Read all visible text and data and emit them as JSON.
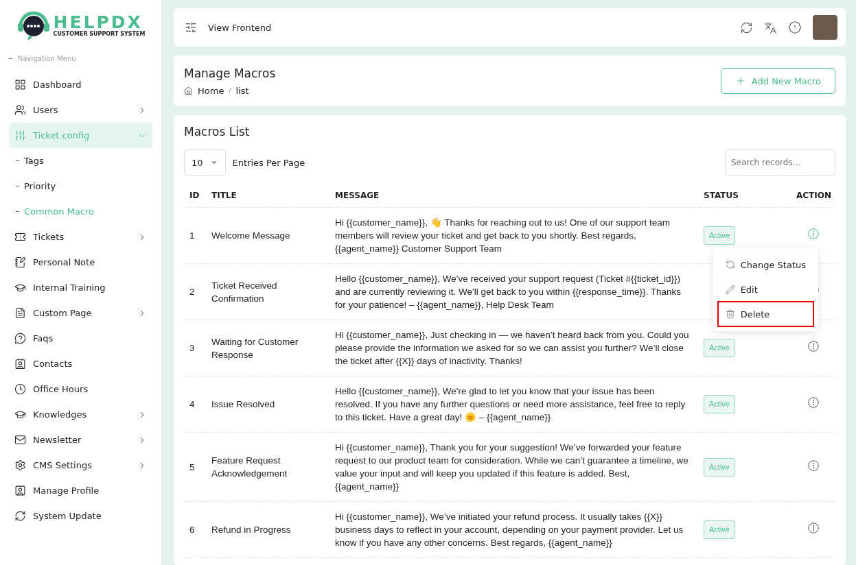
{
  "logo": {
    "name": "HELPDX",
    "tagline": "CUSTOMER SUPPORT SYSTEM"
  },
  "sidebar": {
    "heading": "Navigation Menu",
    "items": [
      {
        "label": "Dashboard",
        "selected": false
      },
      {
        "label": "Users",
        "expanded": false,
        "selected": false
      },
      {
        "label": "Ticket config",
        "expanded": true,
        "selected": true,
        "children": [
          {
            "label": "Tags",
            "selected": false
          },
          {
            "label": "Priority",
            "selected": false
          },
          {
            "label": "Common Macro",
            "selected": true
          }
        ]
      },
      {
        "label": "Tickets",
        "expanded": false,
        "selected": false
      },
      {
        "label": "Personal Note",
        "selected": false
      },
      {
        "label": "Internal Training",
        "selected": false
      },
      {
        "label": "Custom Page",
        "expanded": false,
        "selected": false
      },
      {
        "label": "Faqs",
        "selected": false
      },
      {
        "label": "Contacts",
        "selected": false
      },
      {
        "label": "Office Hours",
        "selected": false
      },
      {
        "label": "Knowledges",
        "expanded": false,
        "selected": false
      },
      {
        "label": "Newsletter",
        "expanded": false,
        "selected": false
      },
      {
        "label": "CMS Settings",
        "expanded": false,
        "selected": false
      },
      {
        "label": "Manage Profile",
        "selected": false
      },
      {
        "label": "System Update",
        "selected": false
      }
    ]
  },
  "topbar": {
    "link": "View Frontend"
  },
  "page_header": {
    "title": "Manage Macros",
    "breadcrumb": [
      "Home",
      "list"
    ],
    "breadcrumb_separator": "/",
    "add_button": "Add New Macro"
  },
  "list": {
    "title": "Macros List",
    "per_page": "10",
    "per_page_label": "Entries Per Page",
    "search": {
      "placeholder": "Search records..."
    },
    "columns": [
      "ID",
      "TITLE",
      "MESSAGE",
      "STATUS",
      "ACTION"
    ],
    "rows": [
      {
        "id": "1",
        "title": "Welcome Message",
        "message": "Hi {{customer_name}}, 👋 Thanks for reaching out to us! One of our support team members will review your ticket and get back to you shortly. Best regards, {{agent_name}} Customer Support Team",
        "status": "Active",
        "menu_open": true
      },
      {
        "id": "2",
        "title": "Ticket Received Confirmation",
        "message": "Hello {{customer_name}}, We've received your support request (Ticket #{{ticket_id}}) and are currently reviewing it. We'll get back to you within {{response_time}}. Thanks for your patience! – {{agent_name}}, Help Desk Team",
        "status": "",
        "menu_open": false
      },
      {
        "id": "3",
        "title": "Waiting for Customer Response",
        "message": "Hi {{customer_name}}, Just checking in — we haven’t heard back from you. Could you please provide the information we asked for so we can assist you further? We’ll close the ticket after {{X}} days of inactivity. Thanks!",
        "status": "Active",
        "menu_open": false
      },
      {
        "id": "4",
        "title": "Issue Resolved",
        "message": "Hello {{customer_name}}, We're glad to let you know that your issue has been resolved. If you have any further questions or need more assistance, feel free to reply to this ticket. Have a great day! 🌞 – {{agent_name}}",
        "status": "Active",
        "menu_open": false
      },
      {
        "id": "5",
        "title": "Feature Request Acknowledgement",
        "message": "Hi {{customer_name}}, Thank you for your suggestion! We’ve forwarded your feature request to our product team for consideration. While we can’t guarantee a timeline, we value your input and will keep you updated if this feature is added. Best, {{agent_name}}",
        "status": "Active",
        "menu_open": false
      },
      {
        "id": "6",
        "title": "Refund in Progress",
        "message": "Hi {{customer_name}}, We’ve initiated your refund process. It usually takes {{X}} business days to reflect in your account, depending on your payment provider. Let us know if you have any other concerns. Best regards, {{agent_name}}",
        "status": "Active",
        "menu_open": false
      }
    ]
  },
  "action_menu": {
    "items": [
      {
        "kind": "status",
        "label": "Change Status",
        "highlighted": false
      },
      {
        "kind": "edit",
        "label": "Edit",
        "highlighted": false
      },
      {
        "kind": "delete",
        "label": "Delete",
        "highlighted": true
      }
    ]
  }
}
